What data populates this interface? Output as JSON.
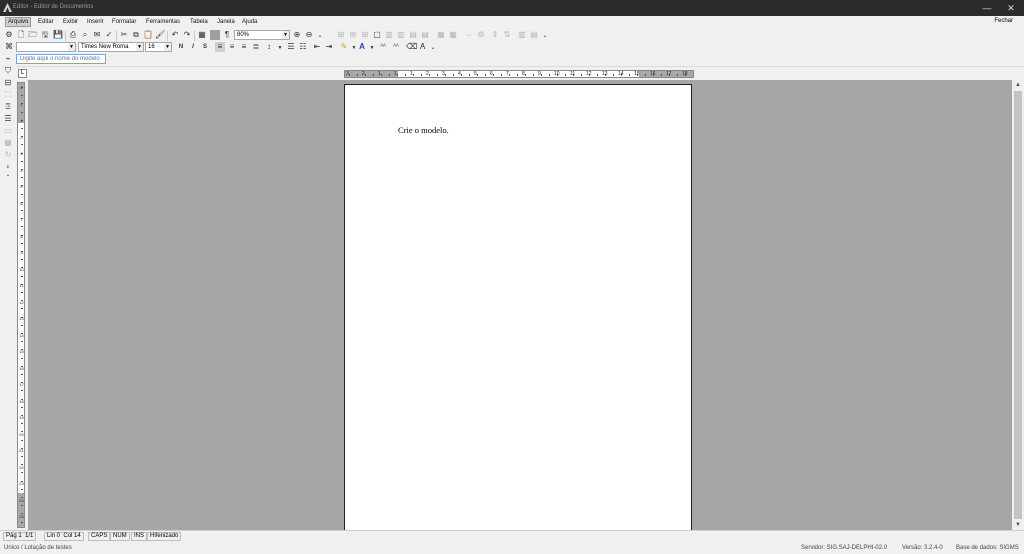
{
  "window": {
    "title": "Editor - Editor de Documentos",
    "minimize": "—",
    "close": "✕"
  },
  "menu": {
    "items": [
      "Arquivo",
      "Editar",
      "Exibir",
      "Inserir",
      "Formatar",
      "Ferramentas",
      "Tabela",
      "Janela",
      "Ajuda"
    ],
    "close_label": "Fechar"
  },
  "format": {
    "style": "",
    "font": "Times New Roma",
    "size": "16",
    "zoom": "80%",
    "bold": "N",
    "italic": "I",
    "underline": "S"
  },
  "model_name": {
    "placeholder": "Digite aqui o nome do modelo"
  },
  "ruler": {
    "h_numbers": [
      "3",
      "2",
      "1",
      "1",
      "1",
      "2",
      "3",
      "4",
      "5",
      "6",
      "7",
      "8",
      "9",
      "10",
      "11",
      "12",
      "13",
      "14",
      "15",
      "16",
      "17",
      "18"
    ],
    "v_numbers": [
      "2",
      "1",
      "1",
      "2",
      "3",
      "4",
      "5",
      "6",
      "7",
      "8",
      "9",
      "10",
      "11",
      "12",
      "13",
      "14",
      "15",
      "16",
      "17",
      "18",
      "19",
      "20",
      "21",
      "22",
      "23",
      "24",
      "25"
    ]
  },
  "document": {
    "text": "Crie o modelo."
  },
  "status": {
    "page": "Pág 1",
    "pages": "1/1",
    "line": "Lin 0",
    "col": "Col 14",
    "caps": "CAPS",
    "num": "NUM",
    "ins": "INS",
    "hyphen": "Hifenizado"
  },
  "info": {
    "user": "Unico / Lotação de testes",
    "server": "Servidor: SIG.SAJ-DELPHI-02.0",
    "version": "Versão: 3.2.4-0",
    "database": "Base de dados: SIGMS"
  },
  "icons": {
    "app": "app-logo-icon",
    "toolbar1": [
      "new-icon",
      "open-icon",
      "save-icon",
      "save-as-icon",
      "print-icon",
      "print-preview-icon",
      "spell-check-icon",
      "cut-icon",
      "copy-icon",
      "paste-icon",
      "format-painter-icon",
      "undo-icon",
      "redo-icon",
      "table-icon",
      "color-swatch-icon",
      "paragraph-mark-icon",
      "zoom-in-icon",
      "zoom-out-icon"
    ],
    "toolbar2": [
      "align-left-icon",
      "align-center-icon",
      "align-right-icon",
      "justify-icon",
      "line-spacing-icon",
      "bullets-icon",
      "numbering-icon",
      "outdent-icon",
      "indent-icon",
      "highlight-icon",
      "font-color-icon",
      "grow-font-icon",
      "shrink-font-icon"
    ]
  },
  "colors": {
    "titlebar": "#2b2b2b",
    "workspace": "#a6a6a6",
    "accent": "#3a7bd5"
  }
}
